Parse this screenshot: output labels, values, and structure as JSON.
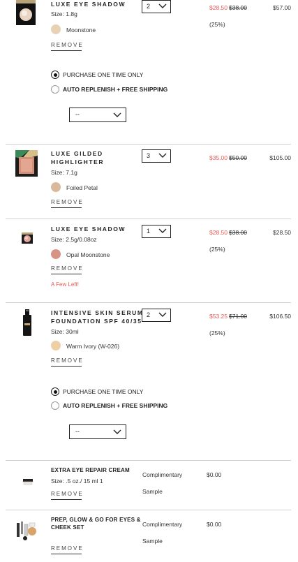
{
  "items": [
    {
      "name": "LUXE EYE SHADOW",
      "size": "Size: 1.8g",
      "shade": "Moonstone",
      "shade_color": "#e8d2b6",
      "remove": "REMOVE",
      "qty": "2",
      "sale_price": "$28.50",
      "old_price": "$38.00",
      "discount": "(25%)",
      "total": "$57.00",
      "purchase_once": "PURCHASE ONE TIME ONLY",
      "auto_replenish": "AUTO REPLENISH + FREE SHIPPING",
      "frequency": "--"
    },
    {
      "name_line1": "LUXE GILDED",
      "name_line2": "HIGHLIGHTER",
      "size": "Size: 7.1g",
      "shade": "Foiled Petal",
      "shade_color": "#d9b89c",
      "remove": "REMOVE",
      "qty": "3",
      "sale_price": "$35.00",
      "old_price": "$50.00",
      "total": "$105.00"
    },
    {
      "name": "LUXE EYE SHADOW",
      "size": "Size: 2.5g/0.08oz",
      "shade": "Opal Moonstone",
      "shade_color": "#d99286",
      "remove": "REMOVE",
      "qty": "1",
      "sale_price": "$28.50",
      "old_price": "$38.00",
      "discount": "(25%)",
      "total": "$28.50",
      "stock_note": "A Few Left!"
    },
    {
      "name_line1": "INTENSIVE SKIN SERUM",
      "name_line2": "FOUNDATION SPF 40/35",
      "size": "Size: 30ml",
      "shade": "Warm Ivory (W-026)",
      "shade_color": "#eed0a4",
      "remove": "REMOVE",
      "qty": "2",
      "sale_price": "$53.25",
      "old_price": "$71.00",
      "discount": "(25%)",
      "total": "$106.50",
      "purchase_once": "PURCHASE ONE TIME ONLY",
      "auto_replenish": "AUTO REPLENISH + FREE SHIPPING",
      "frequency": "--"
    },
    {
      "name": "EXTRA EYE REPAIR CREAM",
      "size": "Size: .5 oz./ 15 ml 1",
      "remove": "REMOVE",
      "comp_line1": "Complimentary",
      "comp_line2": "Sample",
      "price": "$0.00"
    },
    {
      "name_line1": "PREP, GLOW & GO FOR EYES &",
      "name_line2": "CHEEK SET",
      "remove": "REMOVE",
      "comp_line1": "Complimentary",
      "comp_line2": "Sample",
      "price": "$0.00"
    }
  ]
}
